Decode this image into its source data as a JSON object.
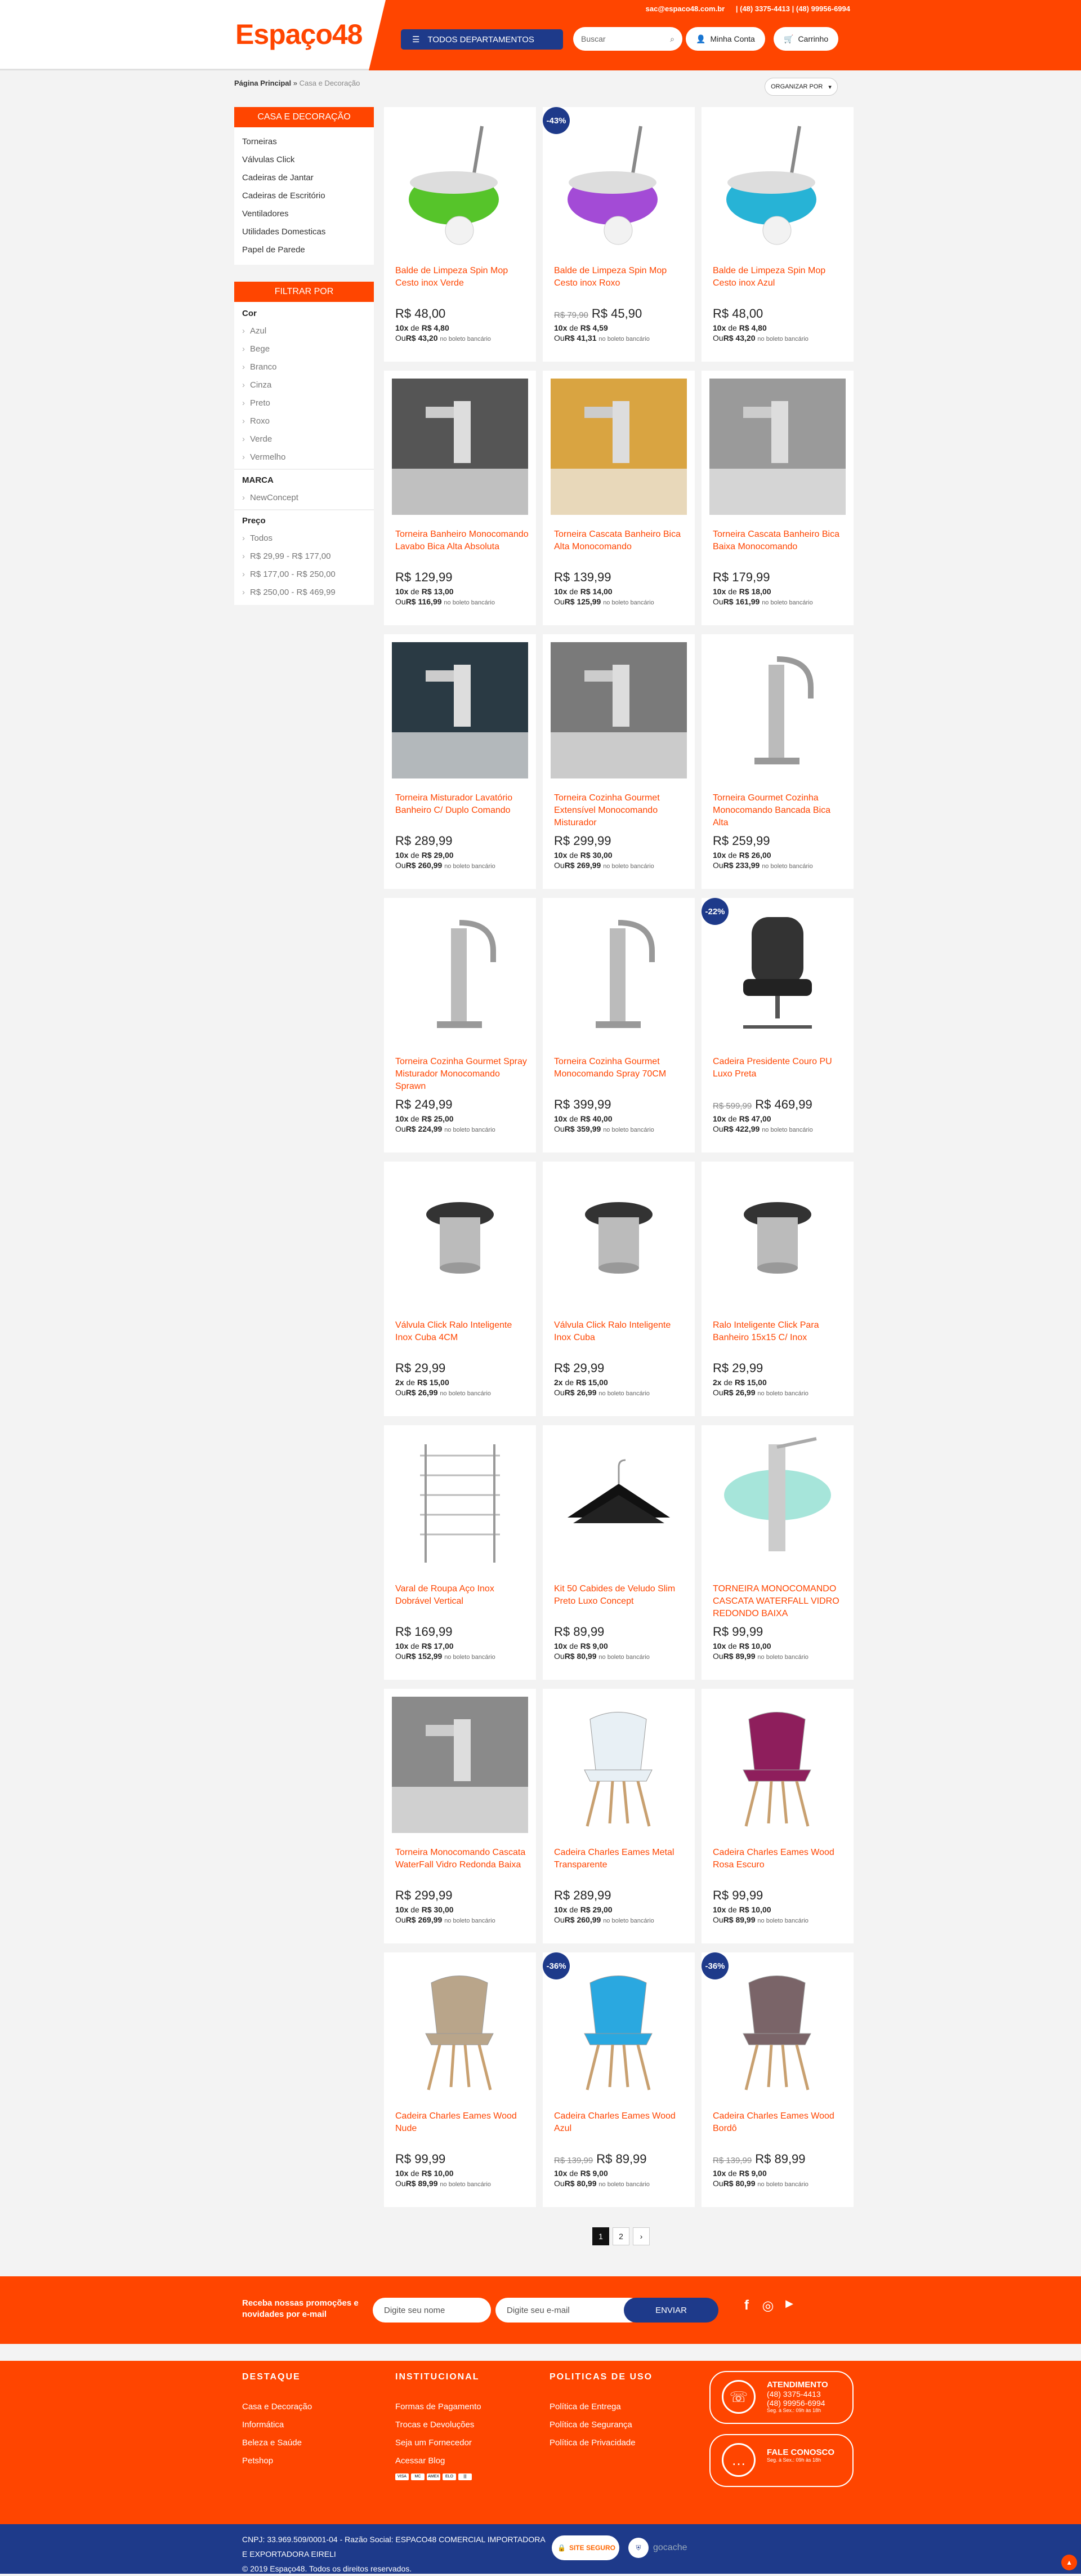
{
  "header": {
    "logo": "Espaço48",
    "email": "sac@espaco48.com.br",
    "phones": "| (48) 3375-4413 | (48) 99956-6994",
    "departments_label": "TODOS DEPARTAMENTOS",
    "search_placeholder": "Buscar",
    "account_label": "Minha Conta",
    "cart_label": "Carrinho"
  },
  "breadcrumb": {
    "home": "Página Principal",
    "current": "Casa e Decoração"
  },
  "sort_label": "ORGANIZAR POR",
  "sidebar": {
    "title": "CASA E DECORAÇÃO",
    "items": [
      "Torneiras",
      "Válvulas Click",
      "Cadeiras de Jantar",
      "Cadeiras de Escritório",
      "Ventiladores",
      "Utilidades Domesticas",
      "Papel de Parede"
    ],
    "filter_title": "FILTRAR POR",
    "color_title": "Cor",
    "colors": [
      "Azul",
      "Bege",
      "Branco",
      "Cinza",
      "Preto",
      "Roxo",
      "Verde",
      "Vermelho"
    ],
    "brand_title": "MARCA",
    "brands": [
      "NewConcept"
    ],
    "price_title": "Preço",
    "prices": [
      "Todos",
      "R$ 29,99 - R$ 177,00",
      "R$ 177,00 - R$ 250,00",
      "R$ 250,00 - R$ 469,99"
    ]
  },
  "products": [
    {
      "name": "Balde de Limpeza Spin Mop Cesto inox Verde",
      "old": "",
      "price": "R$ 48,00",
      "inst": "10x",
      "inst_val": "R$ 4,80",
      "bol": "R$ 43,20",
      "badge": "",
      "img": "mop-green-icon"
    },
    {
      "name": "Balde de Limpeza Spin Mop Cesto inox Roxo",
      "old": "R$ 79,90",
      "price": "R$ 45,90",
      "inst": "10x",
      "inst_val": "R$ 4,59",
      "bol": "R$ 41,31",
      "badge": "-43%",
      "img": "mop-purple-icon"
    },
    {
      "name": "Balde de Limpeza Spin Mop Cesto inox Azul",
      "old": "",
      "price": "R$ 48,00",
      "inst": "10x",
      "inst_val": "R$ 4,80",
      "bol": "R$ 43,20",
      "badge": "",
      "img": "mop-blue-icon"
    },
    {
      "name": "Torneira Banheiro Monocomando Lavabo Bica Alta Absoluta",
      "old": "",
      "price": "R$ 129,99",
      "inst": "10x",
      "inst_val": "R$ 13,00",
      "bol": "R$ 116,99",
      "badge": "",
      "img": "faucet-photo-icon"
    },
    {
      "name": "Torneira Cascata Banheiro Bica Alta Monocomando",
      "old": "",
      "price": "R$ 139,99",
      "inst": "10x",
      "inst_val": "R$ 14,00",
      "bol": "R$ 125,99",
      "badge": "",
      "img": "faucet-waterfall-icon"
    },
    {
      "name": "Torneira Cascata Banheiro Bica Baixa Monocomando",
      "old": "",
      "price": "R$ 179,99",
      "inst": "10x",
      "inst_val": "R$ 18,00",
      "bol": "R$ 161,99",
      "badge": "",
      "img": "faucet-low-icon"
    },
    {
      "name": "Torneira Misturador Lavatório Banheiro C/ Duplo Comando",
      "old": "",
      "price": "R$ 289,99",
      "inst": "10x",
      "inst_val": "R$ 29,00",
      "bol": "R$ 260,99",
      "badge": "",
      "img": "faucet-mixer-icon"
    },
    {
      "name": "Torneira Cozinha Gourmet Extensível Monocomando Misturador",
      "old": "",
      "price": "R$ 299,99",
      "inst": "10x",
      "inst_val": "R$ 30,00",
      "bol": "R$ 269,99",
      "badge": "",
      "img": "faucet-kitchen-icon"
    },
    {
      "name": "Torneira Gourmet Cozinha Monocomando Bancada Bica Alta",
      "old": "",
      "price": "R$ 259,99",
      "inst": "10x",
      "inst_val": "R$ 26,00",
      "bol": "R$ 233,99",
      "badge": "",
      "img": "faucet-gourmet-icon"
    },
    {
      "name": "Torneira Cozinha Gourmet Spray Misturador Monocomando Sprawn",
      "old": "",
      "price": "R$ 249,99",
      "inst": "10x",
      "inst_val": "R$ 25,00",
      "bol": "R$ 224,99",
      "badge": "",
      "img": "faucet-spray-icon"
    },
    {
      "name": "Torneira Cozinha Gourmet Monocomando Spray 70CM",
      "old": "",
      "price": "R$ 399,99",
      "inst": "10x",
      "inst_val": "R$ 40,00",
      "bol": "R$ 359,99",
      "badge": "",
      "img": "faucet-spring-icon"
    },
    {
      "name": "Cadeira Presidente Couro PU Luxo Preta",
      "old": "R$ 599,99",
      "price": "R$ 469,99",
      "inst": "10x",
      "inst_val": "R$ 47,00",
      "bol": "R$ 422,99",
      "badge": "-22%",
      "img": "office-chair-icon"
    },
    {
      "name": "Válvula Click Ralo Inteligente Inox Cuba 4CM",
      "old": "",
      "price": "R$ 29,99",
      "inst": "2x",
      "inst_val": "R$ 15,00",
      "bol": "R$ 26,99",
      "badge": "",
      "img": "valve-icon"
    },
    {
      "name": "Válvula Click Ralo Inteligente Inox Cuba",
      "old": "",
      "price": "R$ 29,99",
      "inst": "2x",
      "inst_val": "R$ 15,00",
      "bol": "R$ 26,99",
      "badge": "",
      "img": "valve-small-icon"
    },
    {
      "name": "Ralo Inteligente Click Para Banheiro 15x15 C/ Inox",
      "old": "",
      "price": "R$ 29,99",
      "inst": "2x",
      "inst_val": "R$ 15,00",
      "bol": "R$ 26,99",
      "badge": "",
      "img": "drain-icon"
    },
    {
      "name": "Varal de Roupa Aço Inox Dobrável Vertical",
      "old": "",
      "price": "R$ 169,99",
      "inst": "10x",
      "inst_val": "R$ 17,00",
      "bol": "R$ 152,99",
      "badge": "",
      "img": "clothes-rack-icon"
    },
    {
      "name": "Kit 50 Cabides de Veludo Slim Preto Luxo Concept",
      "old": "",
      "price": "R$ 89,99",
      "inst": "10x",
      "inst_val": "R$ 9,00",
      "bol": "R$ 80,99",
      "badge": "",
      "img": "hangers-icon"
    },
    {
      "name": "TORNEIRA MONOCOMANDO CASCATA WATERFALL VIDRO REDONDO BAIXA",
      "old": "",
      "price": "R$ 99,99",
      "inst": "10x",
      "inst_val": "R$ 10,00",
      "bol": "R$ 89,99",
      "badge": "",
      "img": "faucet-glass-icon"
    },
    {
      "name": "Torneira Monocomando Cascata WaterFall Vidro Redonda Baixa",
      "old": "",
      "price": "R$ 299,99",
      "inst": "10x",
      "inst_val": "R$ 30,00",
      "bol": "R$ 269,99",
      "badge": "",
      "img": "faucet-curve-icon"
    },
    {
      "name": "Cadeira Charles Eames Metal Transparente",
      "old": "",
      "price": "R$ 289,99",
      "inst": "10x",
      "inst_val": "R$ 29,00",
      "bol": "R$ 260,99",
      "badge": "",
      "img": "chair-clear-icon"
    },
    {
      "name": "Cadeira Charles Eames Wood Rosa Escuro",
      "old": "",
      "price": "R$ 99,99",
      "inst": "10x",
      "inst_val": "R$ 10,00",
      "bol": "R$ 89,99",
      "badge": "",
      "img": "chair-pink-icon"
    },
    {
      "name": "Cadeira Charles Eames Wood Nude",
      "old": "",
      "price": "R$ 99,99",
      "inst": "10x",
      "inst_val": "R$ 10,00",
      "bol": "R$ 89,99",
      "badge": "",
      "img": "chair-nude-icon"
    },
    {
      "name": "Cadeira Charles Eames Wood Azul",
      "old": "R$ 139,99",
      "price": "R$ 89,99",
      "inst": "10x",
      "inst_val": "R$ 9,00",
      "bol": "R$ 80,99",
      "badge": "-36%",
      "img": "chair-blue-icon"
    },
    {
      "name": "Cadeira Charles Eames Wood Bordô",
      "old": "R$ 139,99",
      "price": "R$ 89,99",
      "inst": "10x",
      "inst_val": "R$ 9,00",
      "bol": "R$ 80,99",
      "badge": "-36%",
      "img": "chair-bordo-icon"
    }
  ],
  "card_text": {
    "de": "de",
    "ou": "Ou",
    "boleto": "no boleto bancário"
  },
  "pagination": [
    "1",
    "2",
    "›"
  ],
  "newsletter": {
    "text": "Receba nossas promoções e novidades por e-mail",
    "name_placeholder": "Digite seu nome",
    "email_placeholder": "Digite seu e-mail",
    "button": "ENVIAR"
  },
  "footer": {
    "col1_title": "DESTAQUE",
    "col1": [
      "Casa e Decoração",
      "Informática",
      "Beleza e Saúde",
      "Petshop"
    ],
    "col2_title": "INSTITUCIONAL",
    "col2": [
      "Formas de Pagamento",
      "Trocas e Devoluções",
      "Seja um Fornecedor",
      "Acessar Blog"
    ],
    "col3_title": "POLITICAS DE USO",
    "col3": [
      "Política de Entrega",
      "Política de Segurança",
      "Política de Privacidade"
    ],
    "attend_title": "ATENDIMENTO",
    "attend_phone1": "(48) 3375-4413",
    "attend_phone2": "(48) 99956-6994",
    "attend_hours": "Seg. à Sex.: 09h às 18h",
    "fale_title": "FALE CONOSCO",
    "fale_hours": "Seg. à Sex.: 09h às 18h"
  },
  "bottom": {
    "cnpj": "CNPJ: 33.969.509/0001-04 - Razão Social: ESPACO48 COMERCIAL IMPORTADORA E EXPORTADORA EIRELI",
    "copy": "© 2019 Espaço48. Todos os direitos reservados.",
    "seal1": "SITE SEGURO",
    "seal2": "gocache"
  },
  "colors": {
    "orange": "#ff4500",
    "navy": "#1e3a8a"
  }
}
